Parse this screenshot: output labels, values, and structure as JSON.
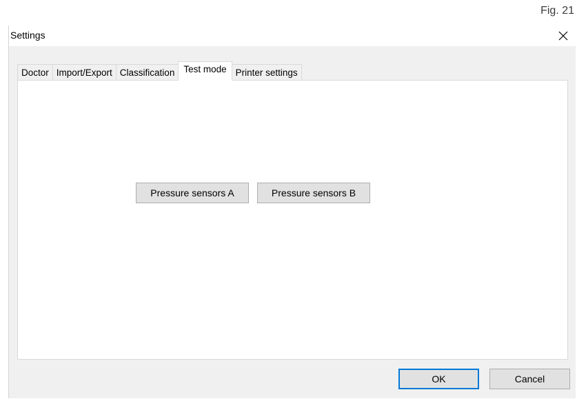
{
  "figure_label": "Fig. 21",
  "dialog": {
    "title": "Settings",
    "close_icon": "close-icon"
  },
  "tabs": [
    {
      "label": "Doctor",
      "active": false
    },
    {
      "label": "Import/Export",
      "active": false
    },
    {
      "label": "Classification",
      "active": false
    },
    {
      "label": "Test mode",
      "active": true
    },
    {
      "label": "Printer settings",
      "active": false
    }
  ],
  "panel": {
    "pressure_a_label": "Pressure sensors A",
    "pressure_b_label": "Pressure sensors B"
  },
  "footer": {
    "ok_label": "OK",
    "cancel_label": "Cancel"
  },
  "colors": {
    "accent": "#0078d7",
    "button_bg": "#e1e1e1",
    "dialog_bg": "#f0f0f0"
  }
}
